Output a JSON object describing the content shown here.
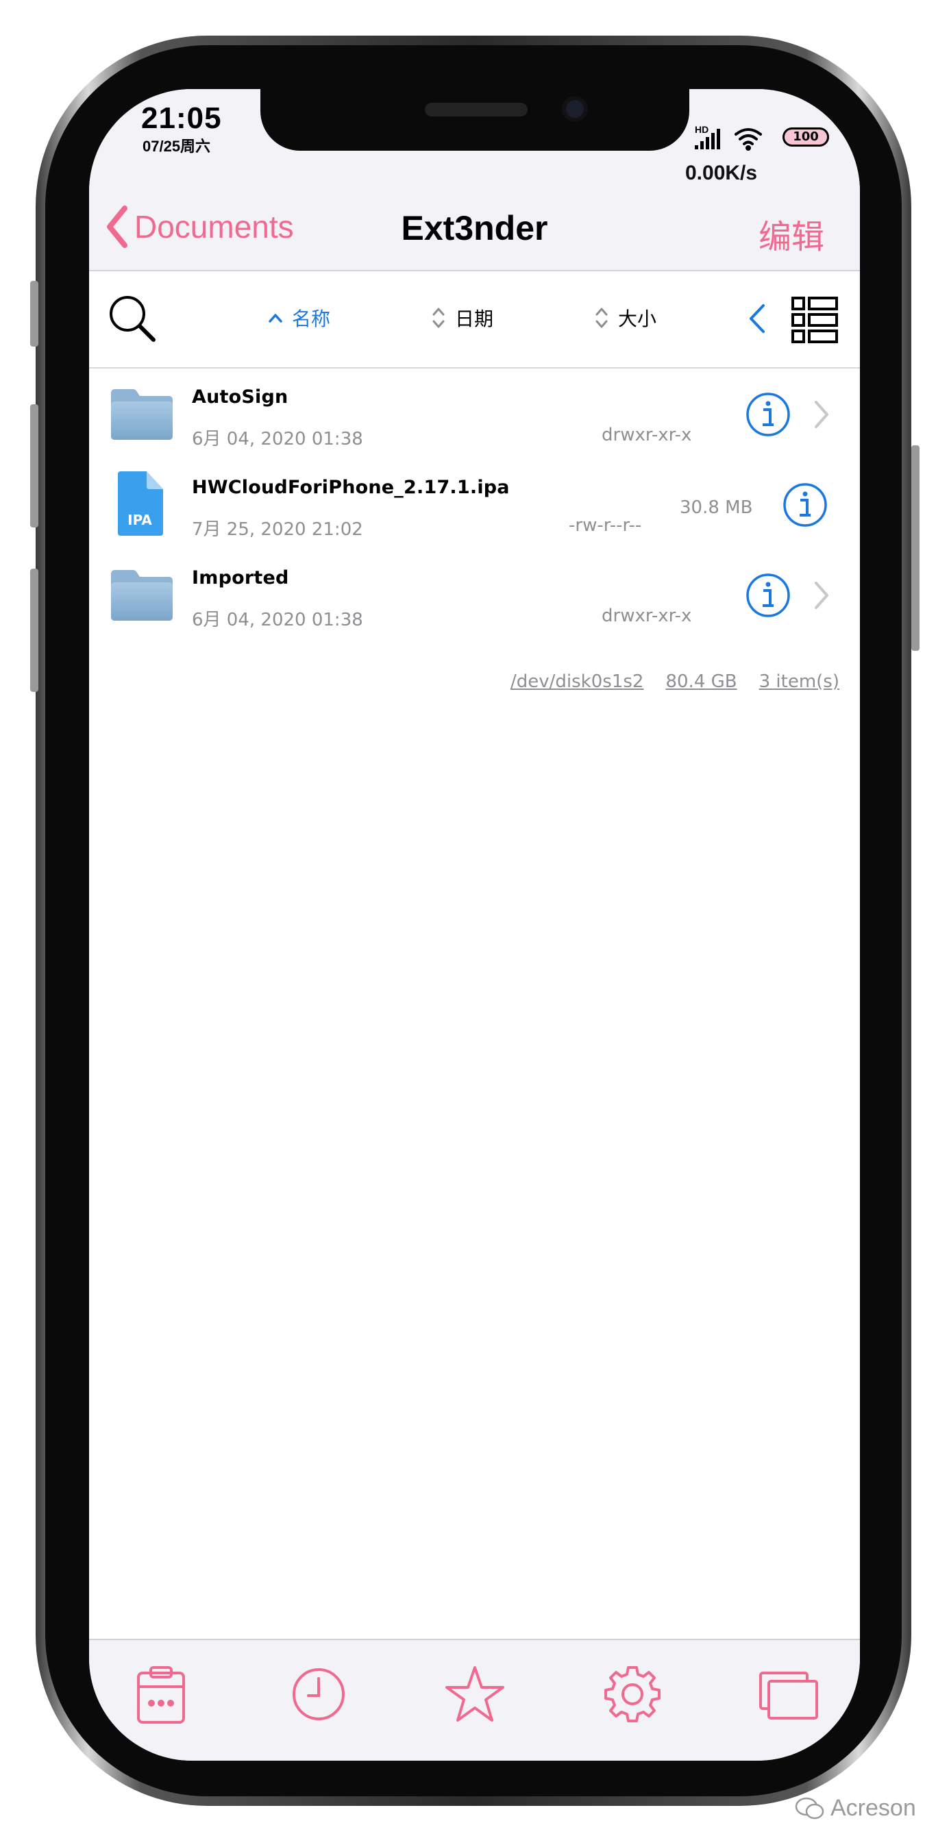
{
  "status_bar": {
    "time": "21:05",
    "date": "07/25周六",
    "network_label": "HD",
    "battery": "100",
    "speed": "0.00K/s"
  },
  "nav": {
    "back_label": "Documents",
    "title": "Ext3nder",
    "edit_label": "编辑"
  },
  "toolbar": {
    "sort_name": "名称",
    "sort_date": "日期",
    "sort_size": "大小",
    "active_sort": "name"
  },
  "files": [
    {
      "name": "AutoSign",
      "date": "6月 04, 2020 01:38",
      "permissions": "drwxr-xr-x",
      "size": "",
      "type": "folder",
      "icon": "folder-icon"
    },
    {
      "name": "HWCloudForiPhone_2.17.1.ipa",
      "date": "7月 25, 2020 21:02",
      "permissions": "-rw-r--r--",
      "size": "30.8 MB",
      "type": "file",
      "icon": "ipa-file-icon",
      "icon_label": "IPA"
    },
    {
      "name": "Imported",
      "date": "6月 04, 2020 01:38",
      "permissions": "drwxr-xr-x",
      "size": "",
      "type": "folder",
      "icon": "folder-icon"
    }
  ],
  "footer": {
    "device": "/dev/disk0s1s2",
    "free_space": "80.4 GB",
    "item_count": "3 item(s)"
  },
  "tabs": [
    {
      "icon": "clipboard-icon"
    },
    {
      "icon": "clock-icon"
    },
    {
      "icon": "star-icon"
    },
    {
      "icon": "gear-icon"
    },
    {
      "icon": "windows-icon"
    }
  ],
  "watermark": "Acreson",
  "colors": {
    "accent_pink": "#f06a90",
    "accent_blue": "#1a78e0",
    "secondary_text": "#8e8e93",
    "bar_background": "#f3f2f7"
  }
}
